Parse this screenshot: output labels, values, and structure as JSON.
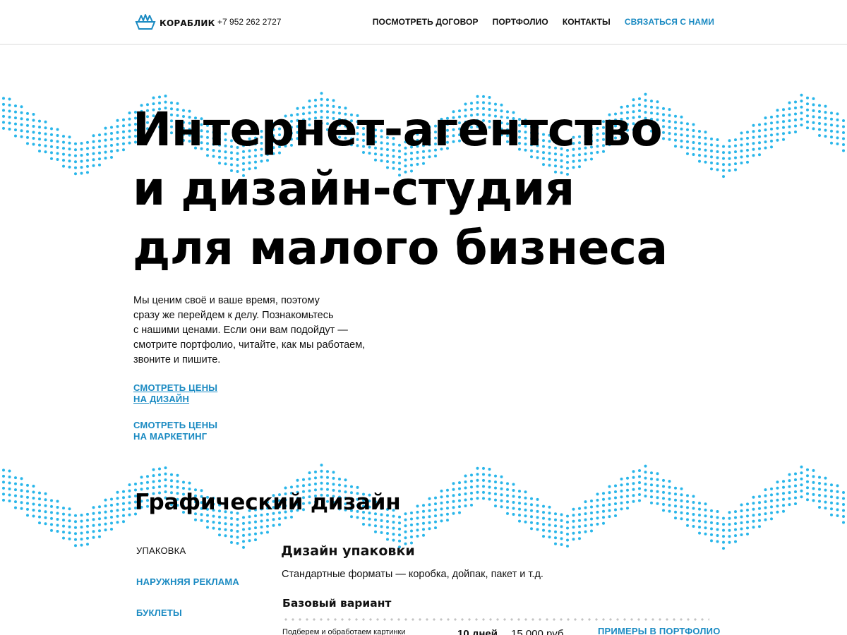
{
  "header": {
    "logo_text": "КОРАБЛИК",
    "phone": "+7 952 262 2727",
    "nav": [
      "ПОСМОТРЕТЬ ДОГОВОР",
      "ПОРТФОЛИО",
      "КОНТАКТЫ",
      "СВЯЗАТЬСЯ С НАМИ"
    ]
  },
  "hero": {
    "title_lines": [
      "Интернет-агентство",
      "и дизайн-студия",
      "для малого бизнеса"
    ],
    "text_lines": [
      "Мы ценим своё и ваше время, поэтому",
      "сразу же перейдем к делу. Познакомьтесь",
      "с нашими ценами. Если они вам подойдут —",
      "смотрите портфолио, читайте, как мы работаем,",
      "звоните и пишите."
    ],
    "link_design": [
      "СМОТРЕТЬ ЦЕНЫ",
      "НА ДИЗАЙН"
    ],
    "link_marketing": [
      "СМОТРЕТЬ ЦЕНЫ",
      "НА МАРКЕТИНГ"
    ]
  },
  "section": {
    "title": "Графический дизайн",
    "side_items": [
      "УПАКОВКА",
      "НАРУЖНЯЯ РЕКЛАМА",
      "БУКЛЕТЫ"
    ],
    "active_index": 0,
    "sub_title": "Дизайн упаковки",
    "sub_desc": "Стандартные форматы — коробка, дойпак, пакет и т.д.",
    "variant": "Базовый вариант",
    "row": {
      "desc": "Подберем и обработаем картинки",
      "days": "10 дней",
      "price": "15 000 руб.",
      "portfolio_link": "ПРИМЕРЫ В ПОРТФОЛИО"
    }
  },
  "colors": {
    "accent": "#1a8ac2",
    "dots": "#29b6ea",
    "text": "#111111"
  },
  "icons": {
    "logo": "paper-boat-icon"
  }
}
